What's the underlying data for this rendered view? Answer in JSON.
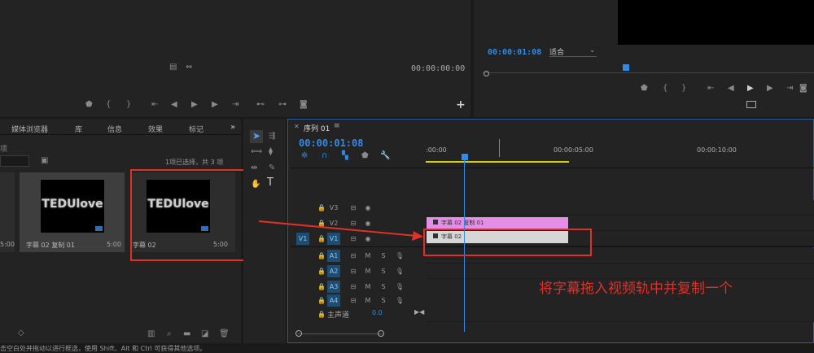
{
  "source_monitor": {
    "timecode": "00:00:00:00"
  },
  "program_monitor": {
    "timecode": "00:00:01:08",
    "zoom_label": "适合"
  },
  "project_panel": {
    "tabs": [
      "媒体浏览器",
      "库",
      "信息",
      "效果",
      "标记"
    ],
    "selection_status": "1项已选择，共 3 项",
    "items": [
      {
        "thumb_text": "TEDUlove",
        "name": "字幕 02 复制 01",
        "duration": "5:00"
      },
      {
        "thumb_text": "TEDUlove",
        "name": "字幕 02",
        "duration": "5:00"
      }
    ],
    "partial_duration": "5:00",
    "partial_left_label": "项"
  },
  "timeline": {
    "tab_label": "序列 01",
    "timecode": "00:00:01:08",
    "ruler_labels": [
      ":00:00",
      "00:00:05:00",
      "00:00:10:00"
    ],
    "video_tracks": [
      "V3",
      "V2",
      "V1"
    ],
    "audio_tracks": [
      "A1",
      "A2",
      "A3",
      "A4"
    ],
    "source_patch": "V1",
    "master_label": "主声道",
    "master_value": "0.0",
    "clips": [
      {
        "track": "V2",
        "label": "字幕 02 复制 01",
        "color": "#e58ee6"
      },
      {
        "track": "V1",
        "label": "字幕 02",
        "color": "#d6d6d6"
      }
    ]
  },
  "annotation": {
    "text": "将字幕拖入视频轨中并复制一个",
    "color": "#e0302a"
  },
  "status_bar": {
    "text": "单击空白处并拖动以进行框选，使用 Shift、Alt 和 Ctrl 可获得其他选项。"
  },
  "colors": {
    "accent": "#2d8ceb",
    "work_area": "#d9d000",
    "playhead": "#2d8ceb"
  }
}
